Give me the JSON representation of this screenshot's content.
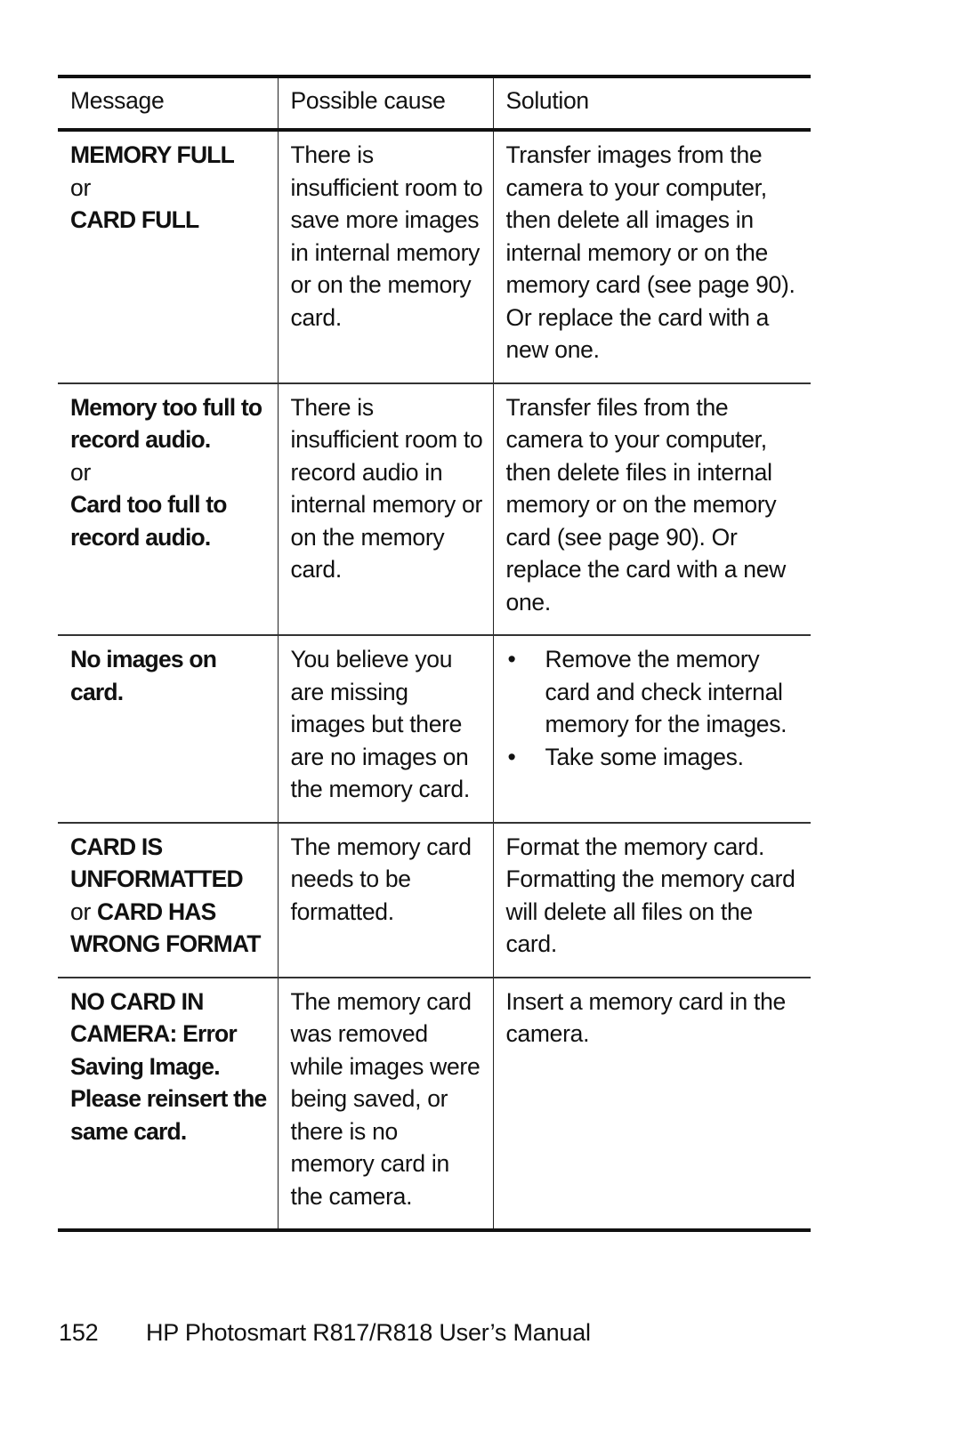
{
  "table": {
    "headers": {
      "message": "Message",
      "cause": "Possible cause",
      "solution": "Solution"
    },
    "rows": [
      {
        "message": {
          "lines": [
            {
              "text": "MEMORY FULL",
              "style": "bold"
            },
            {
              "text": "or",
              "style": "normal"
            },
            {
              "text": "CARD FULL",
              "style": "bold"
            }
          ]
        },
        "cause": "There is insufficient room to save more images in internal memory or on the memory card.",
        "solution": "Transfer images from the camera to your computer, then delete all images in internal memory or on the memory card (see page 90). Or replace the card with a new one."
      },
      {
        "message": {
          "lines": [
            {
              "text": "Memory too full to record audio.",
              "style": "bold"
            },
            {
              "text": "or",
              "style": "normal"
            },
            {
              "text": "Card too full to record audio.",
              "style": "bold"
            }
          ]
        },
        "cause": "There is insufficient room to record audio in internal memory or on the memory card.",
        "solution": "Transfer files from the camera to your computer, then delete files in internal memory or on the memory card (see page 90). Or replace the card with a new one."
      },
      {
        "message": {
          "lines": [
            {
              "text": "No images on card.",
              "style": "bold"
            }
          ]
        },
        "cause": "You believe you are missing images but there are no images on the memory card.",
        "solution_bullets": [
          "Remove the memory card and check internal memory for the images.",
          "Take some images."
        ]
      },
      {
        "message": {
          "lines": [
            {
              "text": "CARD IS UNFORMATTED",
              "style": "bold"
            },
            {
              "prefix": "or",
              "text": "CARD HAS WRONG FORMAT",
              "style": "bold"
            }
          ]
        },
        "cause": "The memory card needs to be formatted.",
        "solution": "Format the memory card. Formatting the memory card will delete all files on the card."
      },
      {
        "message": {
          "lines": [
            {
              "text": "NO CARD IN CAMERA: Error Saving Image. Please reinsert the same card.",
              "style": "bold"
            }
          ]
        },
        "cause": "The memory card was removed while images were being saved, or there is no memory card in the camera.",
        "solution": "Insert a memory card in the camera."
      }
    ],
    "bullet_glyph": "•"
  },
  "footer": {
    "page_number": "152",
    "title": "HP Photosmart R817/R818 User’s Manual"
  }
}
